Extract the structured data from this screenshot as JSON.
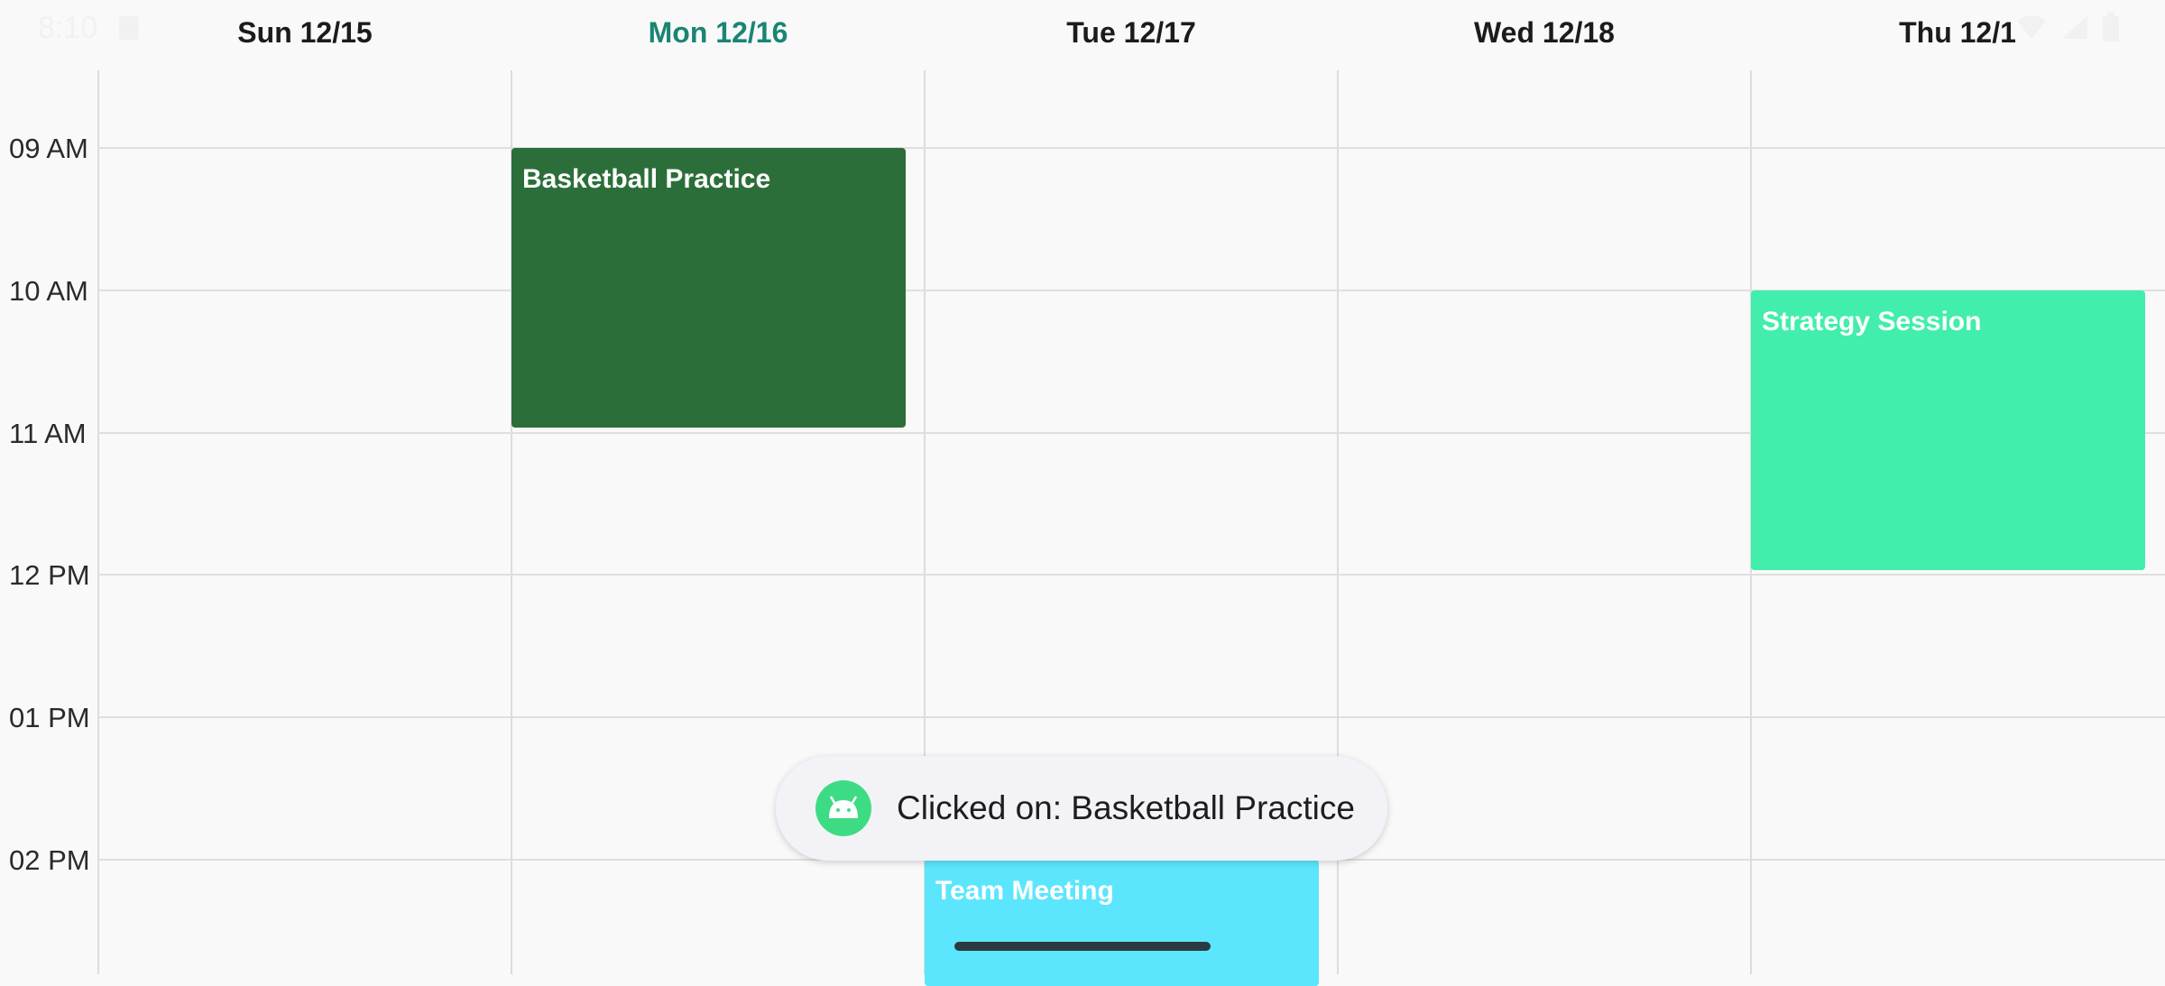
{
  "status_bar": {
    "time": "8:10",
    "icons": [
      "a-icon",
      "wifi-icon",
      "signal-icon",
      "battery-icon"
    ],
    "color": "#f1f1f1"
  },
  "calendar": {
    "days": [
      {
        "label": "Sun 12/15",
        "today": false
      },
      {
        "label": "Mon 12/16",
        "today": true
      },
      {
        "label": "Tue 12/17",
        "today": false
      },
      {
        "label": "Wed 12/18",
        "today": false
      },
      {
        "label": "Thu 12/1",
        "today": false
      }
    ],
    "times": [
      "09 AM",
      "10 AM",
      "11 AM",
      "12 PM",
      "01 PM",
      "02 PM"
    ],
    "events": [
      {
        "title": "Basketball Practice",
        "day": "Mon 12/16",
        "start": "09 AM",
        "end": "11 AM",
        "color": "#2c6e3a"
      },
      {
        "title": "Strategy Session",
        "day": "Thu 12/1",
        "start": "10 AM",
        "end": "12 PM",
        "color": "#41eeab"
      },
      {
        "title": "Team Meeting",
        "day": "Tue 12/17",
        "start": "02 PM",
        "end": "",
        "color": "#5be6fd"
      }
    ],
    "today_color": "#1a8573"
  },
  "toast": {
    "message": "Clicked on: Basketball Practice",
    "icon": "android-icon"
  }
}
